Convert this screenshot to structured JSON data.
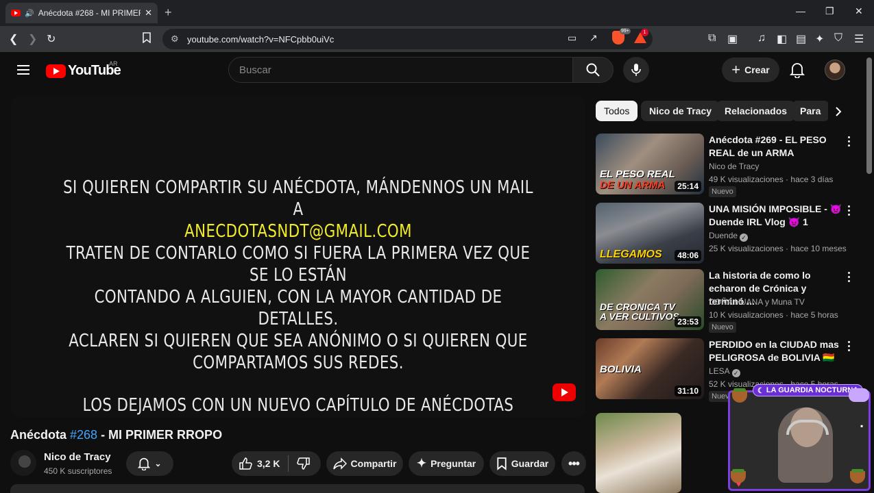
{
  "browser": {
    "tab_title": "Anécdota #268 - MI PRIMER R",
    "url": "youtube.com/watch?v=NFCpbb0uiVc",
    "brave_badge": "99+",
    "rewards_badge": "1"
  },
  "header": {
    "logo_text": "YouTube",
    "country_code": "AR",
    "search_placeholder": "Buscar",
    "create_label": "Crear"
  },
  "player": {
    "line1": "SI QUIEREN COMPARTIR SU ANÉCDOTA, MÁNDENNOS UN MAIL A",
    "email": "ANECDOTASNDT@GMAIL.COM",
    "line3": "TRATEN DE CONTARLO COMO SI FUERA LA PRIMERA VEZ QUE SE LO ESTÁN",
    "line4": "CONTANDO A ALGUIEN, CON LA MAYOR CANTIDAD DE DETALLES.",
    "line5": "ACLAREN SI QUIEREN QUE SEA ANÓNIMO O SI QUIEREN QUE",
    "line6": "COMPARTAMOS SUS REDES.",
    "line7": "LOS DEJAMOS CON UN NUEVO CAPÍTULO DE ANÉCDOTAS"
  },
  "video": {
    "title_start": "Anécdota ",
    "title_tag": "#268",
    "title_end": " - MI PRIMER RROPO",
    "channel": "Nico de Tracy",
    "subscribers": "450 K suscriptores",
    "likes": "3,2 K",
    "share_label": "Compartir",
    "ask_label": "Preguntar",
    "save_label": "Guardar"
  },
  "chips": [
    "Todos",
    "Nico de Tracy",
    "Relacionados",
    "Para"
  ],
  "recommendations": [
    {
      "title": "Anécdota #269  - EL PESO REAL de un ARMA",
      "channel": "Nico de Tracy",
      "meta": "49 K visualizaciones · hace 3 días",
      "badge": "Nuevo",
      "duration": "25:14",
      "thumb_text_1": "EL PESO REAL",
      "thumb_text_2": "DE UN ARMA"
    },
    {
      "title": "UNA MISIÓN IMPOSIBLE - 👿 Duende IRL Vlog 👿 1",
      "channel": "Duende",
      "meta": "25 K visualizaciones · hace 10 meses",
      "duration": "48:06",
      "thumb_text_1": "LLEGAMOS"
    },
    {
      "title": "La historia de como lo echaron de Crónica y terminó ...",
      "channel": "DOÑA HUANA y Muna TV",
      "meta": "10 K visualizaciones · hace 5 horas",
      "badge": "Nuevo",
      "duration": "23:53",
      "thumb_text_1": "DE CRONICA TV",
      "thumb_text_2": "A VER CULTIVOS"
    },
    {
      "title": "PERDIDO en la CIUDAD mas PELIGROSA de BOLIVIA 🇧🇴",
      "channel": "LESA",
      "meta": "52 K visualizaciones · hace 5 horas",
      "badge": "Nuevo",
      "duration": "31:10",
      "thumb_text_1": "BOLIVIA"
    }
  ],
  "overlay": {
    "tag": "LA GUARDIA NOCTURNA"
  },
  "colors": {
    "bg": "#0f0f0f",
    "accent_red": "#ff0000",
    "link_blue": "#3ea6ff",
    "email_yellow": "#f1ec2a",
    "overlay_purple": "#7b3fe4"
  }
}
